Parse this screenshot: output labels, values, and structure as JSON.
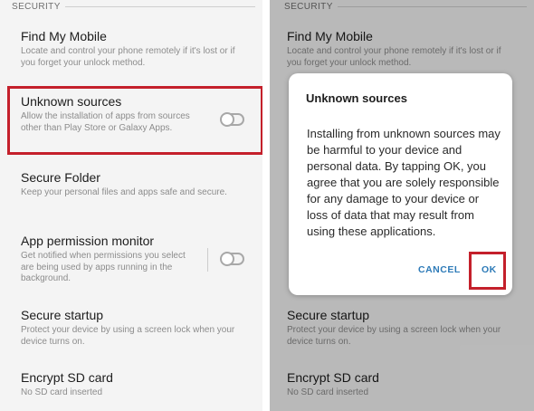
{
  "left": {
    "section_header": "SECURITY",
    "items": [
      {
        "title": "Find My Mobile",
        "desc": "Locate and control your phone remotely if it's lost or if you forget your unlock method."
      },
      {
        "title": "Unknown sources",
        "desc": "Allow the installation of apps from sources other than Play Store or Galaxy Apps."
      },
      {
        "title": "Secure Folder",
        "desc": "Keep your personal files and apps safe and secure."
      },
      {
        "title": "App permission monitor",
        "desc": "Get notified when permissions you select are being used by apps running in the background."
      },
      {
        "title": "Secure startup",
        "desc": "Protect your device by using a screen lock when your device turns on."
      },
      {
        "title": "Encrypt SD card",
        "desc": "No SD card inserted"
      }
    ]
  },
  "right": {
    "section_header": "SECURITY",
    "items": [
      {
        "title": "Find My Mobile",
        "desc": "Locate and control your phone remotely if it's lost or if you forget your unlock method."
      },
      {
        "title": "Secure startup",
        "desc": "Protect your device by using a screen lock when your device turns on."
      },
      {
        "title": "Encrypt SD card",
        "desc": "No SD card inserted"
      }
    ],
    "dialog": {
      "title": "Unknown sources",
      "body": "Installing from unknown sources may be harmful to your device and personal data. By tapping OK, you agree that you are solely responsible for any damage to your device or loss of data that may result from using these applications.",
      "cancel_label": "CANCEL",
      "ok_label": "OK"
    }
  },
  "colors": {
    "highlight": "#c4202b",
    "dialog_button": "#2e7bb8"
  }
}
